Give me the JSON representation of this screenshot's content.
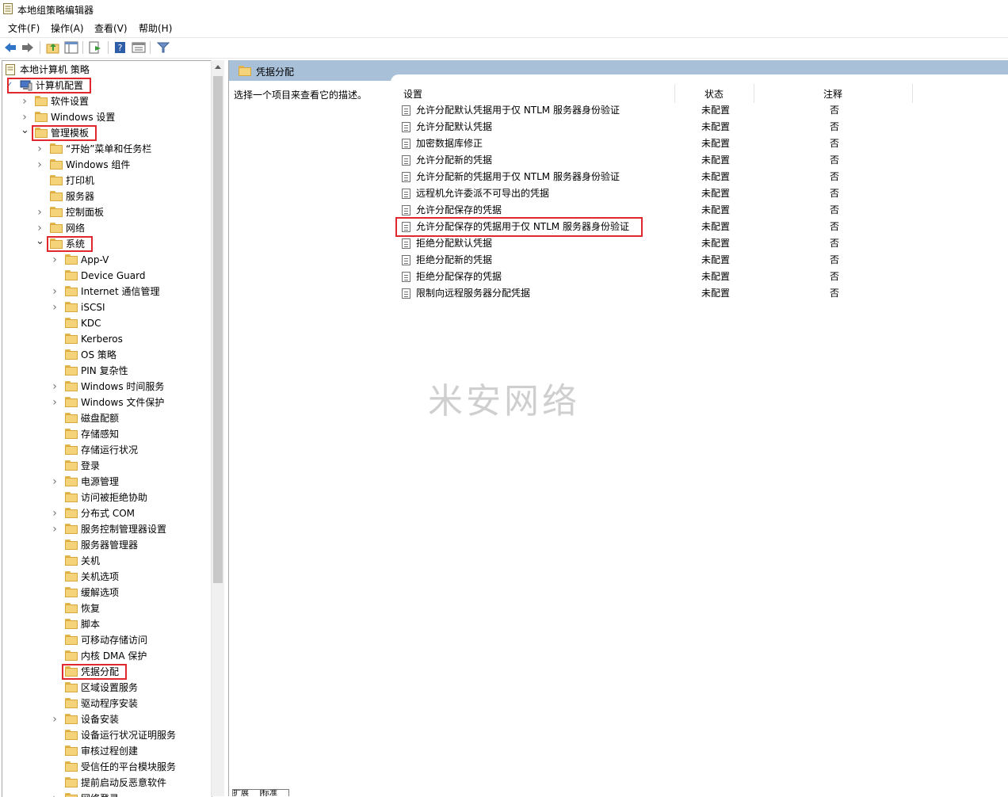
{
  "window": {
    "title": "本地组策略编辑器",
    "app_icon": "policy-icon"
  },
  "menu": [
    "文件(F)",
    "操作(A)",
    "查看(V)",
    "帮助(H)"
  ],
  "toolbar": [
    "back-arrow-icon",
    "forward-arrow-icon",
    "up-folder-icon",
    "show-hide-tree-icon",
    "export-list-icon",
    "help-icon",
    "properties-icon",
    "filter-icon"
  ],
  "tree": {
    "root": "本地计算机 策略",
    "items": [
      {
        "label": "计算机配置",
        "highlight": true
      },
      {
        "label": "软件设置"
      },
      {
        "label": "Windows 设置"
      },
      {
        "label": "管理模板",
        "highlight": true
      },
      {
        "label": "“开始”菜单和任务栏"
      },
      {
        "label": "Windows 组件"
      },
      {
        "label": "打印机"
      },
      {
        "label": "服务器"
      },
      {
        "label": "控制面板"
      },
      {
        "label": "网络"
      },
      {
        "label": "系统",
        "highlight": true
      },
      {
        "label": "App-V"
      },
      {
        "label": "Device Guard"
      },
      {
        "label": "Internet 通信管理"
      },
      {
        "label": "iSCSI"
      },
      {
        "label": "KDC"
      },
      {
        "label": "Kerberos"
      },
      {
        "label": "OS 策略"
      },
      {
        "label": "PIN 复杂性"
      },
      {
        "label": "Windows 时间服务"
      },
      {
        "label": "Windows 文件保护"
      },
      {
        "label": "磁盘配额"
      },
      {
        "label": "存储感知"
      },
      {
        "label": "存储运行状况"
      },
      {
        "label": "登录"
      },
      {
        "label": "电源管理"
      },
      {
        "label": "访问被拒绝协助"
      },
      {
        "label": "分布式 COM"
      },
      {
        "label": "服务控制管理器设置"
      },
      {
        "label": "服务器管理器"
      },
      {
        "label": "关机"
      },
      {
        "label": "关机选项"
      },
      {
        "label": "缓解选项"
      },
      {
        "label": "恢复"
      },
      {
        "label": "脚本"
      },
      {
        "label": "可移动存储访问"
      },
      {
        "label": "内核 DMA 保护"
      },
      {
        "label": "凭据分配",
        "highlight": true
      },
      {
        "label": "区域设置服务"
      },
      {
        "label": "驱动程序安装"
      },
      {
        "label": "设备安装"
      },
      {
        "label": "设备运行状况证明服务"
      },
      {
        "label": "审核过程创建"
      },
      {
        "label": "受信任的平台模块服务"
      },
      {
        "label": "提前启动反恶意软件"
      },
      {
        "label": "网络登录"
      }
    ]
  },
  "right": {
    "header_title": "凭据分配",
    "description": "选择一个项目来查看它的描述。",
    "columns": [
      "设置",
      "状态",
      "注释"
    ],
    "rows": [
      {
        "setting": "允许分配默认凭据用于仅 NTLM 服务器身份验证",
        "state": "未配置",
        "note": "否"
      },
      {
        "setting": "允许分配默认凭据",
        "state": "未配置",
        "note": "否"
      },
      {
        "setting": "加密数据库修正",
        "state": "未配置",
        "note": "否"
      },
      {
        "setting": "允许分配新的凭据",
        "state": "未配置",
        "note": "否"
      },
      {
        "setting": "允许分配新的凭据用于仅 NTLM 服务器身份验证",
        "state": "未配置",
        "note": "否"
      },
      {
        "setting": "远程机允许委派不可导出的凭据",
        "state": "未配置",
        "note": "否"
      },
      {
        "setting": "允许分配保存的凭据",
        "state": "未配置",
        "note": "否"
      },
      {
        "setting": "允许分配保存的凭据用于仅 NTLM 服务器身份验证",
        "state": "未配置",
        "note": "否",
        "highlight": true
      },
      {
        "setting": "拒绝分配默认凭据",
        "state": "未配置",
        "note": "否"
      },
      {
        "setting": "拒绝分配新的凭据",
        "state": "未配置",
        "note": "否"
      },
      {
        "setting": "拒绝分配保存的凭据",
        "state": "未配置",
        "note": "否"
      },
      {
        "setting": "限制向远程服务器分配凭据",
        "state": "未配置",
        "note": "否"
      }
    ],
    "watermark": "米安网络"
  },
  "bottom_tabs": [
    "扩展",
    "标准"
  ],
  "colors": {
    "header_band": "#a9c0d9",
    "highlight_box": "#e0282e",
    "folder": "#f5d37a"
  }
}
